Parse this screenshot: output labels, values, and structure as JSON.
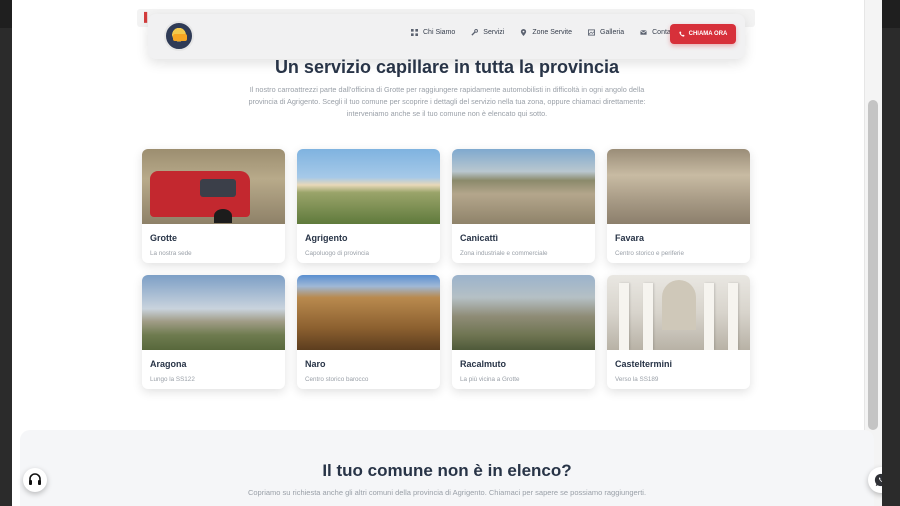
{
  "header": {
    "logo_alt": "logo",
    "nav": [
      {
        "label": "Chi Siamo",
        "icon": "grid-icon"
      },
      {
        "label": "Servizi",
        "icon": "wrench-icon"
      },
      {
        "label": "Zone Servite",
        "icon": "map-pin-icon"
      },
      {
        "label": "Galleria",
        "icon": "gallery-icon"
      },
      {
        "label": "Contatti",
        "icon": "mail-icon"
      }
    ],
    "cta_label": "CHIAMA ORA",
    "accent_color": "#d7303a"
  },
  "hero": {
    "title": "Un servizio capillare in tutta la provincia",
    "text": "Il nostro carroattrezzi parte dall'officina di Grotte per raggiungere rapidamente automobilisti in difficoltà in ogni angolo della provincia di Agrigento. Scegli il tuo comune per scoprire i dettagli del servizio nella tua zona, oppure chiamaci direttamente: interveniamo anche se il tuo comune non è elencato qui sotto."
  },
  "towns": [
    {
      "name": "Grotte",
      "subtitle": "La nostra sede"
    },
    {
      "name": "Agrigento",
      "subtitle": "Capoluogo di provincia"
    },
    {
      "name": "Canicattì",
      "subtitle": "Zona industriale e commerciale"
    },
    {
      "name": "Favara",
      "subtitle": "Centro storico e periferie"
    },
    {
      "name": "Aragona",
      "subtitle": "Lungo la SS122"
    },
    {
      "name": "Naro",
      "subtitle": "Centro storico barocco"
    },
    {
      "name": "Racalmuto",
      "subtitle": "La più vicina a Grotte"
    },
    {
      "name": "Casteltermini",
      "subtitle": "Verso la SS189"
    }
  ],
  "bottom": {
    "title": "Il tuo comune non è in elenco?",
    "text": "Copriamo su richiesta anche gli altri comuni della provincia di Agrigento. Chiamaci per sapere se possiamo raggiungerti."
  }
}
